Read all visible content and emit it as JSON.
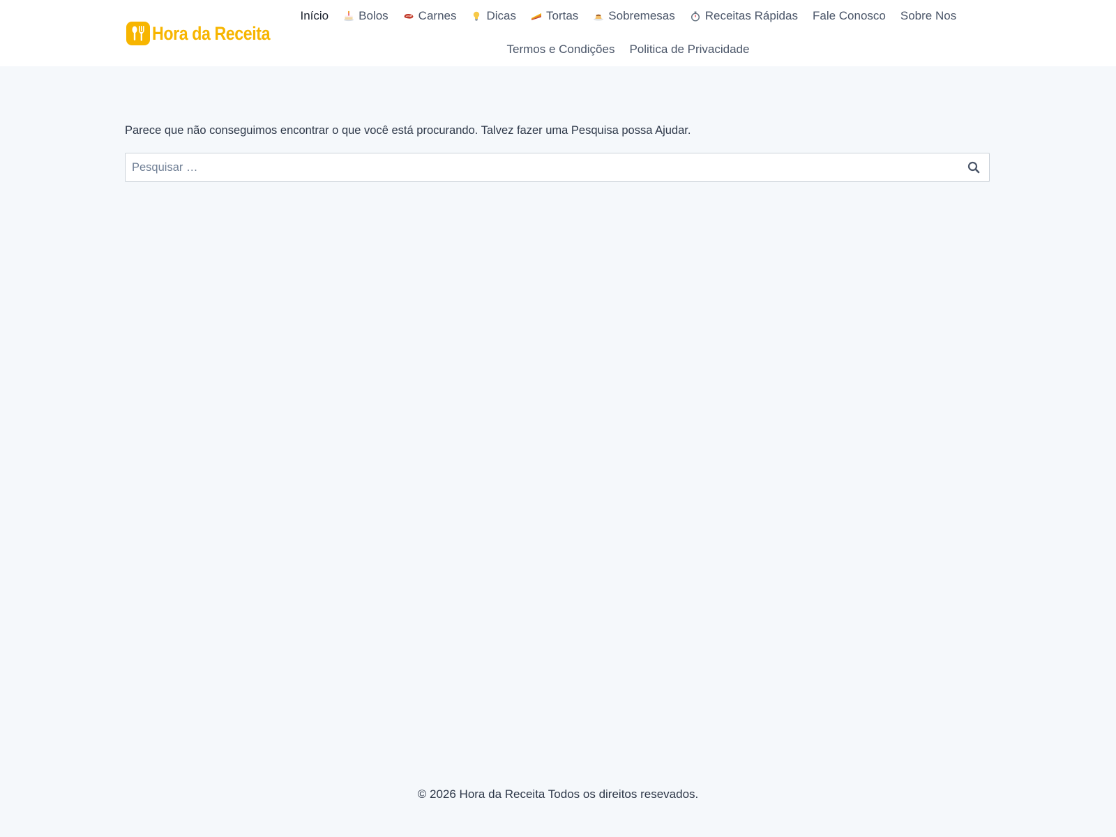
{
  "site": {
    "name": "Hora da Receita"
  },
  "colors": {
    "brand": "#f7b500",
    "background": "#f5f8fb",
    "text": "#2d3748",
    "nav_text": "#4a5568"
  },
  "nav": {
    "row1": [
      {
        "label": "Início",
        "icon": "",
        "active": true
      },
      {
        "label": "Bolos",
        "icon": "cake-icon"
      },
      {
        "label": "Carnes",
        "icon": "meat-icon"
      },
      {
        "label": "Dicas",
        "icon": "lightbulb-icon"
      },
      {
        "label": "Tortas",
        "icon": "pie-icon"
      },
      {
        "label": "Sobremesas",
        "icon": "pudding-icon"
      },
      {
        "label": "Receitas Rápidas",
        "icon": "stopwatch-icon"
      },
      {
        "label": "Fale Conosco",
        "icon": ""
      },
      {
        "label": "Sobre Nos",
        "icon": ""
      }
    ],
    "row2": [
      {
        "label": "Termos e Condições",
        "icon": ""
      },
      {
        "label": "Politica de Privacidade",
        "icon": ""
      }
    ]
  },
  "main": {
    "message": "Parece que não conseguimos encontrar o que você está procurando. Talvez fazer uma Pesquisa possa Ajudar."
  },
  "search": {
    "placeholder": "Pesquisar …",
    "value": "",
    "icon": "search-icon"
  },
  "footer": {
    "text": "© 2026 Hora da Receita Todos os direitos resevados."
  }
}
